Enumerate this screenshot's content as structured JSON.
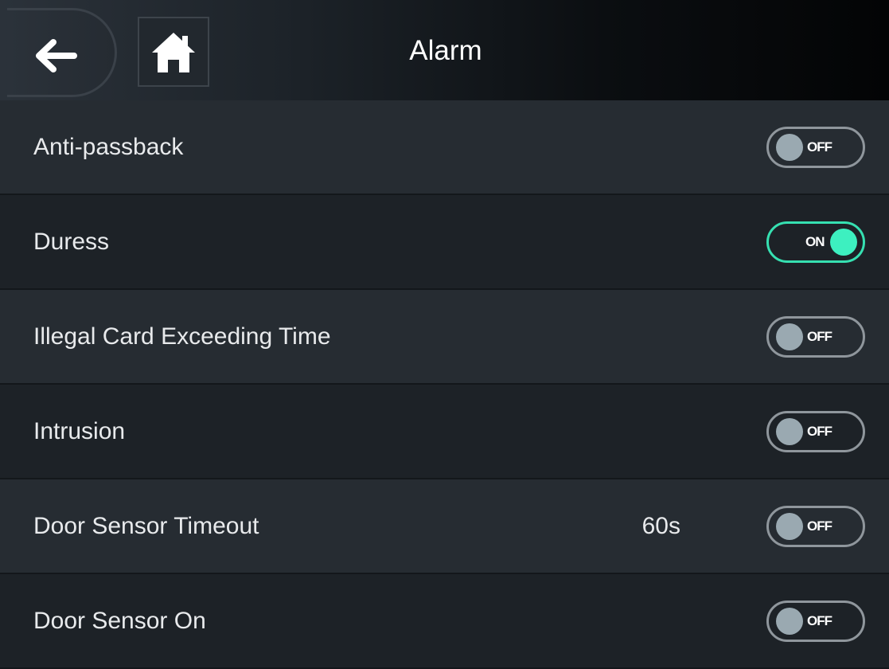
{
  "header": {
    "title": "Alarm",
    "back_icon": "arrow-left-icon",
    "home_icon": "home-icon"
  },
  "colors": {
    "accent_on": "#36e0b1",
    "toggle_off_knob": "#9aa9b1",
    "row_bg_light": "#262c32",
    "row_bg_dark": "#1d2227"
  },
  "rows": [
    {
      "label": "Anti-passback",
      "value": "",
      "toggle": "OFF"
    },
    {
      "label": "Duress",
      "value": "",
      "toggle": "ON"
    },
    {
      "label": "Illegal Card Exceeding Time",
      "value": "",
      "toggle": "OFF"
    },
    {
      "label": "Intrusion",
      "value": "",
      "toggle": "OFF"
    },
    {
      "label": "Door Sensor Timeout",
      "value": "60s",
      "toggle": "OFF"
    },
    {
      "label": "Door Sensor On",
      "value": "",
      "toggle": "OFF"
    }
  ]
}
